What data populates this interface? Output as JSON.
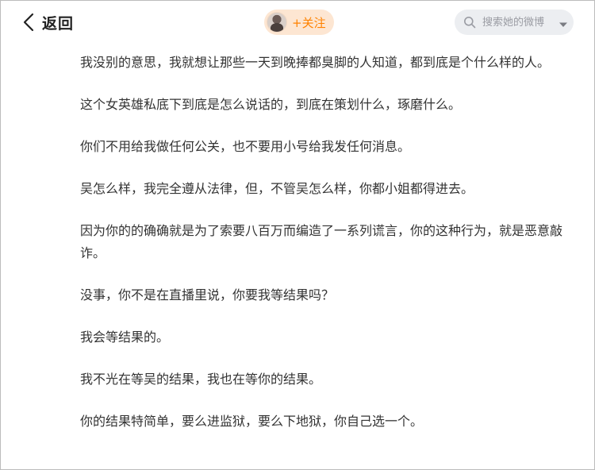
{
  "header": {
    "back_label": "返回",
    "follow_label": "+关注",
    "search_placeholder": "搜索她的微博"
  },
  "icons": {
    "back": "chevron-left-icon",
    "search": "search-icon",
    "dropdown": "chevron-down-icon",
    "avatar": "avatar"
  },
  "colors": {
    "accent": "#ff8200",
    "follow_bg": "#fde6d2",
    "search_bg": "#eceef1",
    "text": "#333333"
  },
  "post": {
    "paragraphs": [
      "我没别的意思，我就想让那些一天到晚捧都臭脚的人知道，都到底是个什么样的人。",
      "这个女英雄私底下到底是怎么说话的，到底在策划什么，琢磨什么。",
      "你们不用给我做任何公关，也不要用小号给我发任何消息。",
      "吴怎么样，我完全遵从法律，但，不管吴怎么样，你都小姐都得进去。",
      "因为你的的确确就是为了索要八百万而编造了一系列谎言，你的这种行为，就是恶意敲诈。",
      "没事，你不是在直播里说，你要我等结果吗？",
      "我会等结果的。",
      "我不光在等吴的结果，我也在等你的结果。",
      "你的结果特简单，要么进监狱，要么下地狱，你自己选一个。"
    ]
  }
}
